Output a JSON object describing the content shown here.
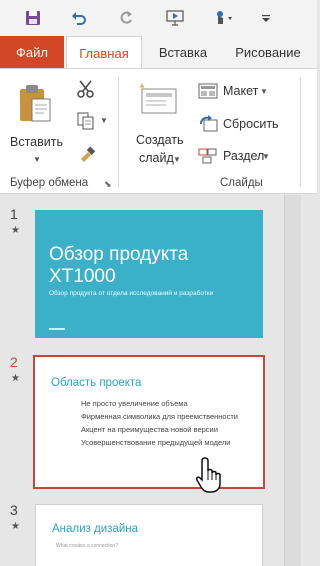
{
  "quick_access": {
    "save_icon": "save-icon",
    "undo_icon": "undo-icon",
    "redo_icon": "redo-icon",
    "present_icon": "present-from-start-icon",
    "touch_icon": "touch-mode-icon",
    "customize_icon": "customize-toolbar-icon"
  },
  "tabs": [
    {
      "label": "Файл"
    },
    {
      "label": "Главная"
    },
    {
      "label": "Вставка"
    },
    {
      "label": "Рисование"
    }
  ],
  "colors": {
    "accent": "#d24726",
    "slide_theme": "#3bb1c9",
    "slide_heading": "#2ba3c4",
    "selected_border": "#c9473a"
  },
  "ribbon": {
    "clipboard": {
      "paste_label": "Вставить",
      "group_label": "Буфер обмена"
    },
    "slides": {
      "new_slide_line1": "Создать",
      "new_slide_line2": "слайд",
      "layout_label": "Макет",
      "reset_label": "Сбросить",
      "section_label": "Раздел",
      "group_label": "Слайды"
    }
  },
  "slides": [
    {
      "number": "1",
      "title": "Обзор продукта XT1000",
      "subtitle": "Обзор продукта от отдела исследований и разработки"
    },
    {
      "number": "2",
      "title": "Область проекта",
      "bullets": [
        "Не просто увеличение объема",
        "Фирменная символика для преемственности",
        "Акцент на преимущества новой версии",
        "Усовершенствование предыдущей модели"
      ]
    },
    {
      "number": "3",
      "title": "Анализ дизайна",
      "subtitle": "What creates a connection?"
    }
  ]
}
